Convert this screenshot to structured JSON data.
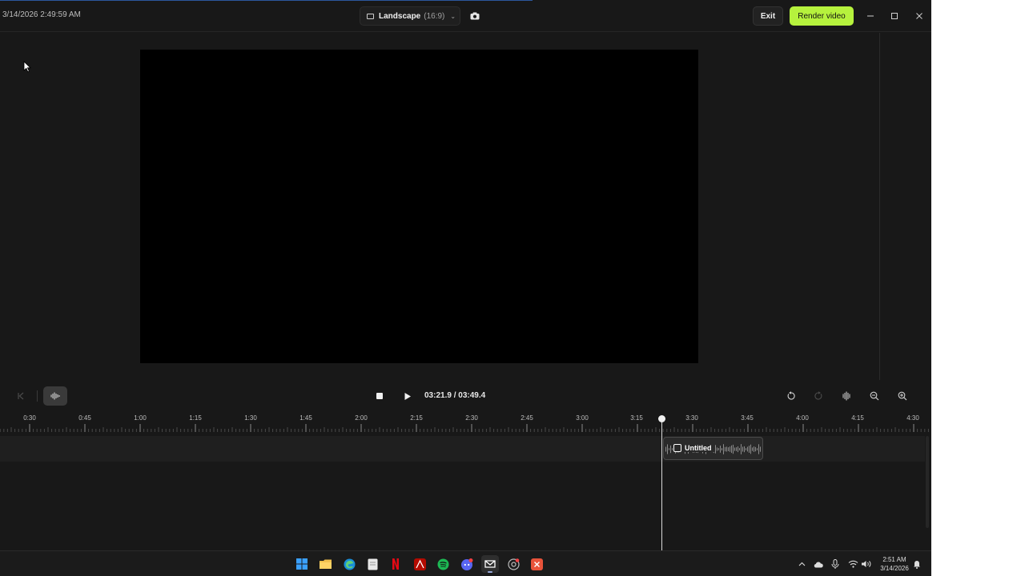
{
  "titlebar": {
    "datetime": "3/14/2026 2:49:59 AM",
    "aspect": {
      "name": "Landscape",
      "ratio": "(16:9)"
    },
    "exit_label": "Exit",
    "render_label": "Render video",
    "accent_color": "#b6f23d"
  },
  "controls": {
    "time_current": "03:21.9",
    "time_total": "03:49.4",
    "time_readout": "03:21.9 / 03:49.4"
  },
  "timeline": {
    "ruler_labels": [
      "0:30",
      "0:45",
      "1:00",
      "1:15",
      "1:30",
      "1:45",
      "2:00",
      "2:15",
      "2:30",
      "2:45",
      "3:00",
      "3:15",
      "3:30",
      "3:45",
      "4:00",
      "4:15",
      "4:30"
    ],
    "clip_title": "Untitled"
  },
  "taskbar": {
    "clock_time": "2:51 AM",
    "clock_date": "3/14/2026",
    "apps": [
      "start-icon",
      "file-explorer-icon",
      "edge-icon",
      "notepad-icon",
      "netflix-icon",
      "acrobat-icon",
      "spotify-icon",
      "discord-icon",
      "capcut-icon",
      "chrome-icon",
      "recorder-icon"
    ]
  }
}
